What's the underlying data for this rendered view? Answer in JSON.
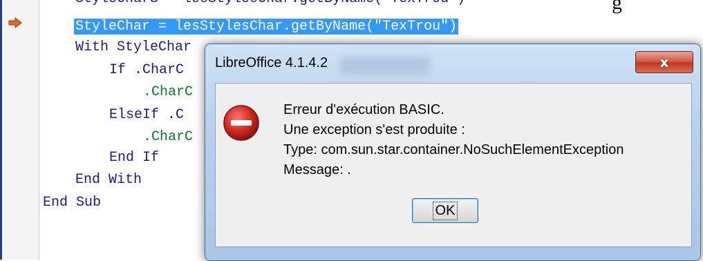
{
  "editor": {
    "top_fragment": "StyleCharS = lesStylesChar.getByName(\"TexTrou\")",
    "top_right_fragment": "g",
    "lines": [
      "StyleChar = lesStylesChar.getByName(\"TexTrou\")",
      "With StyleChar",
      "If .CharC",
      ".CharC",
      "ElseIf .C",
      ".CharC",
      "End If",
      "End With",
      "End Sub"
    ],
    "icons": {
      "breakpoint": "current-line-arrow-icon"
    },
    "colors": {
      "selection": "#3399ff",
      "keyword": "#1a1a80",
      "member": "#0a7a2a",
      "arrow": "#e36a1c"
    }
  },
  "dialog": {
    "title": "LibreOffice 4.1.4.2",
    "close_symbol": "x",
    "message_lines": [
      "Erreur d'exécution BASIC.",
      "Une exception s'est produite :",
      "Type: com.sun.star.container.NoSuchElementException",
      "Message: ."
    ],
    "ok_label": "OK",
    "icons": {
      "error": "error-icon",
      "close": "close-icon"
    },
    "colors": {
      "close_button": "#c0361f",
      "error_icon": "#d12a1f"
    }
  }
}
